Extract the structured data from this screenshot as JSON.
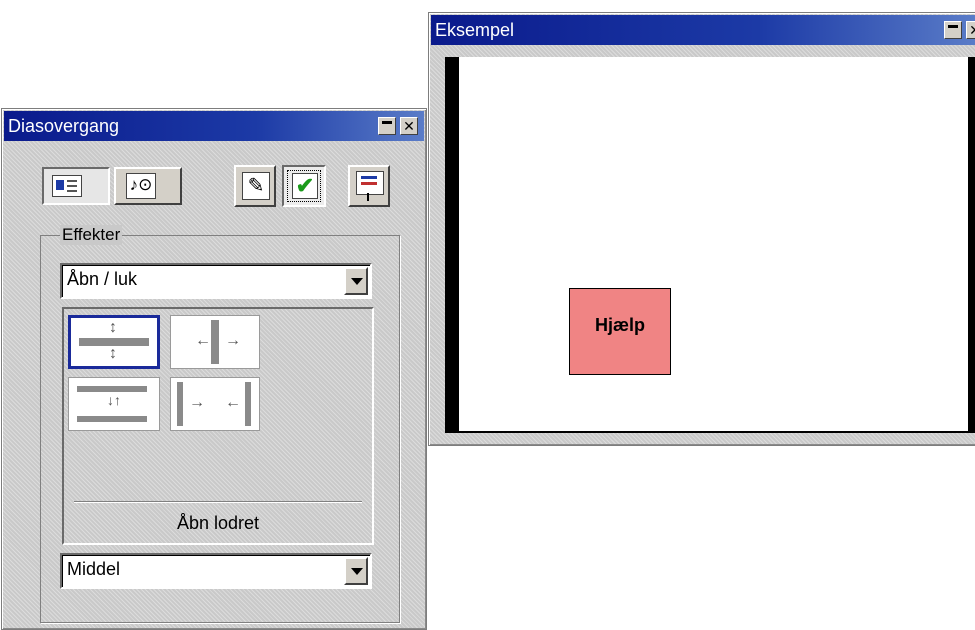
{
  "transition_window": {
    "title": "Diasovergang",
    "toolbar_icons": [
      "slide-transition-icon",
      "sound-icon",
      "pen-icon",
      "checkmark-icon",
      "presentation-icon"
    ],
    "effects_label": "Effekter",
    "effect_category": "Åbn / luk",
    "effects": [
      "open-horizontal",
      "open-vertical",
      "close-horizontal",
      "close-vertical"
    ],
    "selected_effect_name": "Åbn lodret",
    "speed": "Middel"
  },
  "preview_window": {
    "title": "Eksempel",
    "sample_button_label": "Hjælp",
    "sample_button_color": "#f08484"
  }
}
